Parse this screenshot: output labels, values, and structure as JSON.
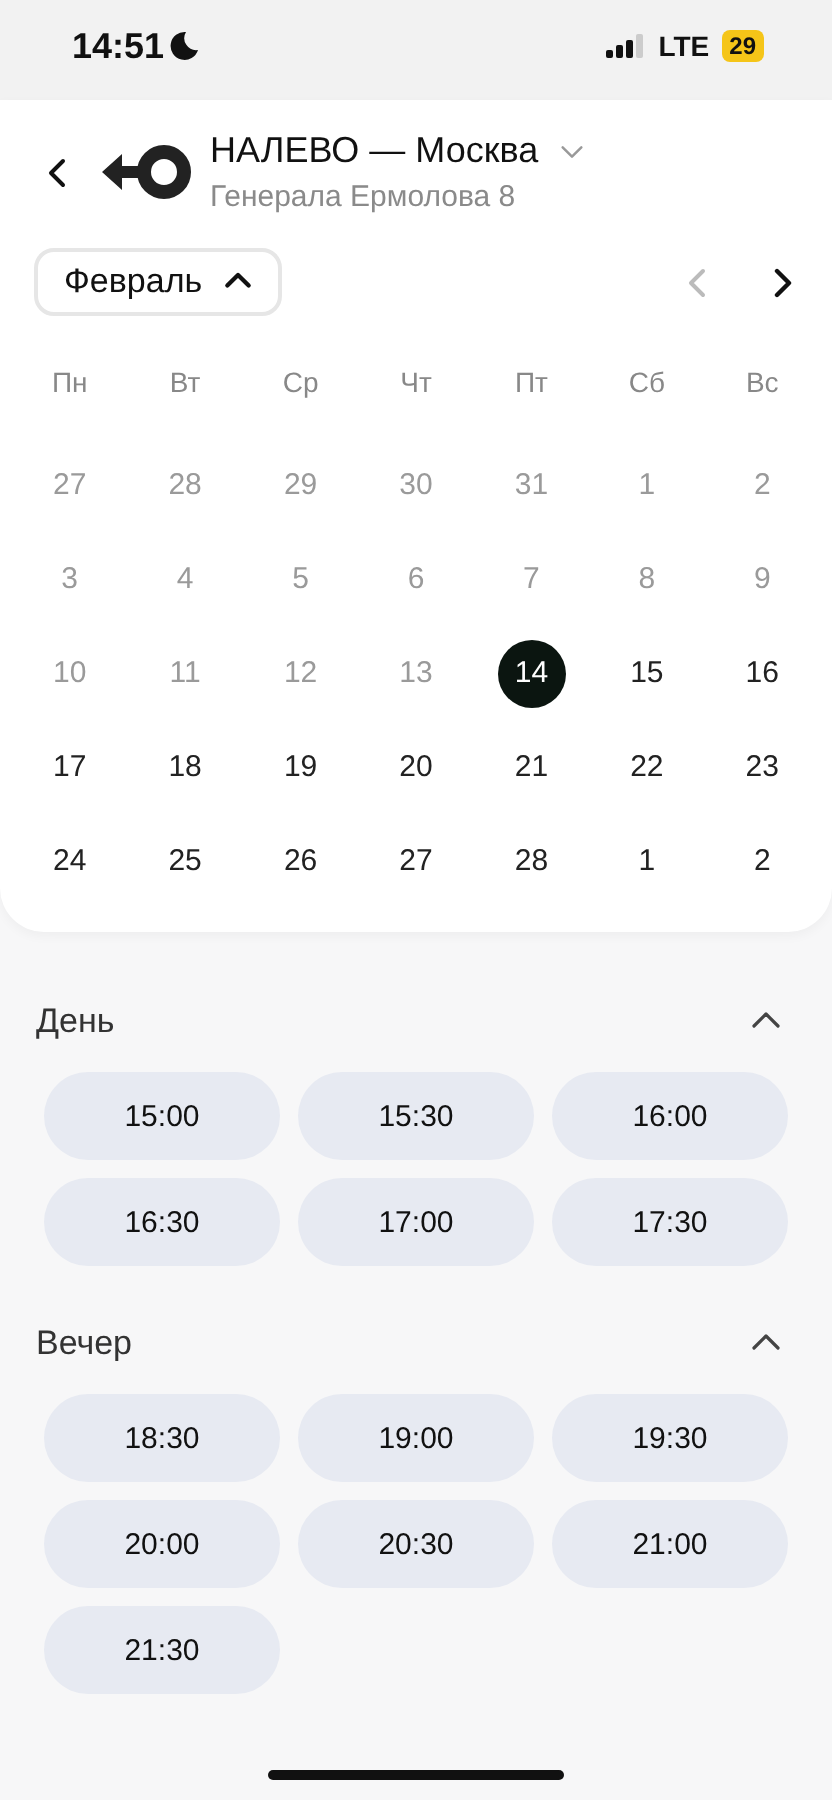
{
  "status_bar": {
    "time": "14:51",
    "network": "LTE",
    "battery": "29"
  },
  "header": {
    "title": "НАЛЕВО — Москва",
    "address": "Генерала Ермолова 8"
  },
  "calendar": {
    "month": "Февраль",
    "month_expanded": true,
    "prev_disabled": true,
    "next_disabled": false,
    "weekdays": [
      "Пн",
      "Вт",
      "Ср",
      "Чт",
      "Пт",
      "Сб",
      "Вс"
    ],
    "days": [
      {
        "label": "27",
        "disabled": true,
        "selected": false
      },
      {
        "label": "28",
        "disabled": true,
        "selected": false
      },
      {
        "label": "29",
        "disabled": true,
        "selected": false
      },
      {
        "label": "30",
        "disabled": true,
        "selected": false
      },
      {
        "label": "31",
        "disabled": true,
        "selected": false
      },
      {
        "label": "1",
        "disabled": true,
        "selected": false
      },
      {
        "label": "2",
        "disabled": true,
        "selected": false
      },
      {
        "label": "3",
        "disabled": true,
        "selected": false
      },
      {
        "label": "4",
        "disabled": true,
        "selected": false
      },
      {
        "label": "5",
        "disabled": true,
        "selected": false
      },
      {
        "label": "6",
        "disabled": true,
        "selected": false
      },
      {
        "label": "7",
        "disabled": true,
        "selected": false
      },
      {
        "label": "8",
        "disabled": true,
        "selected": false
      },
      {
        "label": "9",
        "disabled": true,
        "selected": false
      },
      {
        "label": "10",
        "disabled": true,
        "selected": false
      },
      {
        "label": "11",
        "disabled": true,
        "selected": false
      },
      {
        "label": "12",
        "disabled": true,
        "selected": false
      },
      {
        "label": "13",
        "disabled": true,
        "selected": false
      },
      {
        "label": "14",
        "disabled": false,
        "selected": true
      },
      {
        "label": "15",
        "disabled": false,
        "selected": false
      },
      {
        "label": "16",
        "disabled": false,
        "selected": false
      },
      {
        "label": "17",
        "disabled": false,
        "selected": false
      },
      {
        "label": "18",
        "disabled": false,
        "selected": false
      },
      {
        "label": "19",
        "disabled": false,
        "selected": false
      },
      {
        "label": "20",
        "disabled": false,
        "selected": false
      },
      {
        "label": "21",
        "disabled": false,
        "selected": false
      },
      {
        "label": "22",
        "disabled": false,
        "selected": false
      },
      {
        "label": "23",
        "disabled": false,
        "selected": false
      },
      {
        "label": "24",
        "disabled": false,
        "selected": false
      },
      {
        "label": "25",
        "disabled": false,
        "selected": false
      },
      {
        "label": "26",
        "disabled": false,
        "selected": false
      },
      {
        "label": "27",
        "disabled": false,
        "selected": false
      },
      {
        "label": "28",
        "disabled": false,
        "selected": false
      },
      {
        "label": "1",
        "disabled": false,
        "selected": false
      },
      {
        "label": "2",
        "disabled": false,
        "selected": false
      }
    ]
  },
  "sections": [
    {
      "title": "День",
      "expanded": true,
      "slots": [
        "15:00",
        "15:30",
        "16:00",
        "16:30",
        "17:00",
        "17:30"
      ]
    },
    {
      "title": "Вечер",
      "expanded": true,
      "slots": [
        "18:30",
        "19:00",
        "19:30",
        "20:00",
        "20:30",
        "21:00",
        "21:30"
      ]
    }
  ]
}
